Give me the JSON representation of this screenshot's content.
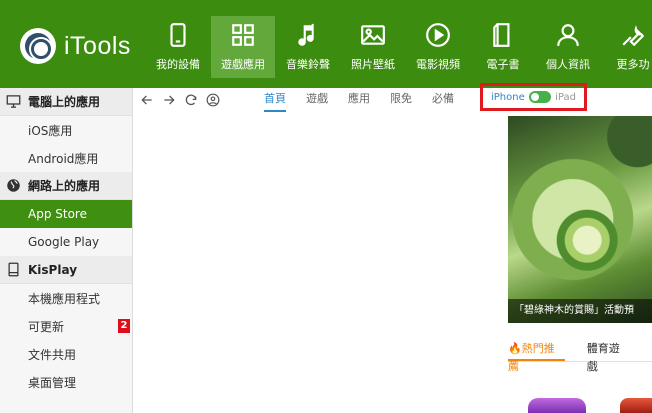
{
  "app": {
    "logo_text": "iTools"
  },
  "nav": [
    {
      "label": "我的設備",
      "icon": "phone-icon"
    },
    {
      "label": "遊戲應用",
      "icon": "grid-icon",
      "active": true
    },
    {
      "label": "音樂鈴聲",
      "icon": "music-note-icon"
    },
    {
      "label": "照片壁紙",
      "icon": "image-icon"
    },
    {
      "label": "電影視頻",
      "icon": "play-circle-icon"
    },
    {
      "label": "電子書",
      "icon": "book-icon"
    },
    {
      "label": "個人資訊",
      "icon": "person-icon"
    },
    {
      "label": "更多功",
      "icon": "wrench-icon"
    }
  ],
  "sidebar": {
    "sections": [
      {
        "title": "電腦上的應用",
        "icon": "monitor-icon",
        "items": [
          "iOS應用",
          "Android應用"
        ]
      },
      {
        "title": "網路上的應用",
        "icon": "globe-icon",
        "items": [
          "App Store",
          "Google Play"
        ]
      },
      {
        "title": "KisPlay",
        "icon": "tablet-icon",
        "items": [
          "本機應用程式",
          "可更新",
          "文件共用",
          "桌面管理"
        ]
      }
    ],
    "active_item": "App Store",
    "update_badge": "2"
  },
  "toolbar": {
    "tabs": [
      "首頁",
      "遊戲",
      "應用",
      "限免",
      "必備"
    ],
    "active_tab": "首頁"
  },
  "device_switch": {
    "iphone_label": "iPhone",
    "ipad_label": "iPad",
    "selected": "iPhone"
  },
  "banner": {
    "caption": "「碧綠神木的賞賜」活動預"
  },
  "section_tabs": {
    "hot_label": "熱門推薦",
    "edu_label": "體育遊戲",
    "active": "熱門推薦"
  },
  "colors": {
    "brand_green": "#3c8d0f",
    "active_blue": "#2f87c9",
    "accent_orange": "#f0850c",
    "badge_red": "#e00d1a",
    "highlight_red": "#e0191f"
  }
}
